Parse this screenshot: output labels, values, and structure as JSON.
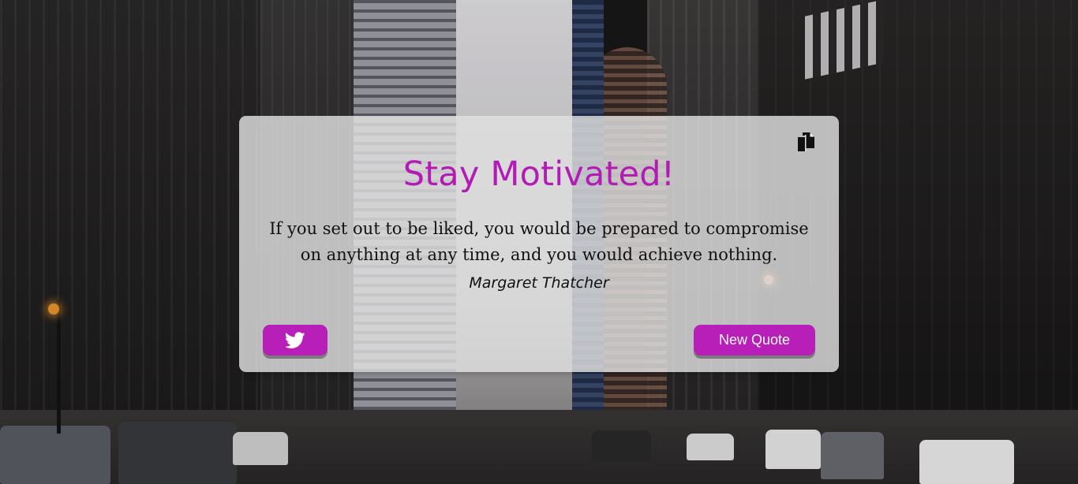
{
  "card": {
    "title": "Stay Motivated!",
    "quote_text": "If you set out to be liked, you would be prepared to compromise on anything at any time, and you would achieve nothing.",
    "author": "Margaret Thatcher"
  },
  "actions": {
    "new_quote_label": "New Quote",
    "twitter_icon": "twitter-icon",
    "copy_icon": "copy-icon"
  },
  "colors": {
    "accent": "#b81fb8",
    "title": "#b31bb5",
    "card_bg": "#e1e1e1"
  }
}
